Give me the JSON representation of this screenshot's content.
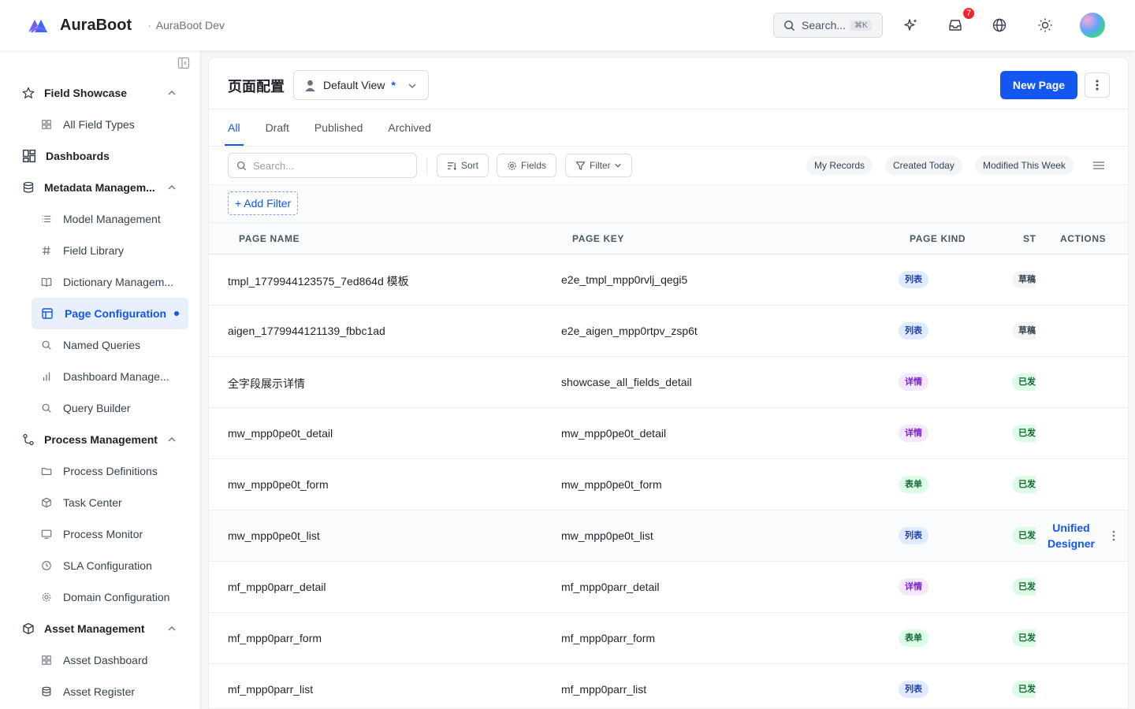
{
  "header": {
    "brand": "AuraBoot",
    "separator": "·",
    "environment": "AuraBoot Dev",
    "search_label": "Search...",
    "search_shortcut": "⌘K",
    "notification_count": "7",
    "icons": [
      "sparkle-icon",
      "inbox-icon",
      "globe-icon",
      "sun-icon"
    ]
  },
  "sidebar": {
    "items": [
      {
        "label": "Field Showcase",
        "kind": "group",
        "icon": "star-icon"
      },
      {
        "label": "All Field Types",
        "kind": "child",
        "icon": "grid-icon"
      },
      {
        "label": "Dashboards",
        "kind": "top",
        "icon": "dashboard-icon"
      },
      {
        "label": "Metadata Managem...",
        "kind": "group",
        "icon": "database-icon"
      },
      {
        "label": "Model Management",
        "kind": "child",
        "icon": "list-icon"
      },
      {
        "label": "Field Library",
        "kind": "child",
        "icon": "hash-icon"
      },
      {
        "label": "Dictionary Managem...",
        "kind": "child",
        "icon": "book-icon"
      },
      {
        "label": "Page Configuration",
        "kind": "active",
        "icon": "layout-icon"
      },
      {
        "label": "Named Queries",
        "kind": "child",
        "icon": "search-icon"
      },
      {
        "label": "Dashboard Manage...",
        "kind": "child",
        "icon": "bar-chart-icon"
      },
      {
        "label": "Query Builder",
        "kind": "child",
        "icon": "search-icon"
      },
      {
        "label": "Process Management",
        "kind": "group",
        "icon": "flow-icon"
      },
      {
        "label": "Process Definitions",
        "kind": "child",
        "icon": "folder-icon"
      },
      {
        "label": "Task Center",
        "kind": "child",
        "icon": "box-icon"
      },
      {
        "label": "Process Monitor",
        "kind": "child",
        "icon": "monitor-icon"
      },
      {
        "label": "SLA Configuration",
        "kind": "child",
        "icon": "clock-icon"
      },
      {
        "label": "Domain Configuration",
        "kind": "child",
        "icon": "gear-icon"
      },
      {
        "label": "Asset Management",
        "kind": "group",
        "icon": "cube-icon"
      },
      {
        "label": "Asset Dashboard",
        "kind": "child",
        "icon": "grid-icon"
      },
      {
        "label": "Asset Register",
        "kind": "child",
        "icon": "database-icon"
      }
    ]
  },
  "page": {
    "title": "页面配置",
    "view_name": "Default View",
    "view_dirty_marker": "*",
    "new_button": "New Page"
  },
  "tabs": [
    "All",
    "Draft",
    "Published",
    "Archived"
  ],
  "toolbar": {
    "search_placeholder": "Search...",
    "sort": "Sort",
    "fields": "Fields",
    "filter": "Filter",
    "quick_filters": [
      "My Records",
      "Created Today",
      "Modified This Week"
    ],
    "add_filter": "+ Add Filter"
  },
  "table": {
    "columns": [
      "PAGE NAME",
      "PAGE KEY",
      "PAGE KIND",
      "ST",
      "ACTIONS"
    ],
    "rows": [
      {
        "name": "tmpl_1779944123575_7ed864d 模板",
        "key": "e2e_tmpl_mpp0rvlj_qegi5",
        "kind": "列表",
        "kind_type": "list",
        "status": "草稿",
        "status_type": "draft"
      },
      {
        "name": "aigen_1779944121139_fbbc1ad",
        "key": "e2e_aigen_mpp0rtpv_zsp6t",
        "kind": "列表",
        "kind_type": "list",
        "status": "草稿",
        "status_type": "draft"
      },
      {
        "name": "全字段展示详情",
        "key": "showcase_all_fields_detail",
        "kind": "详情",
        "kind_type": "detail",
        "status": "已发",
        "status_type": "pub"
      },
      {
        "name": "mw_mpp0pe0t_detail",
        "key": "mw_mpp0pe0t_detail",
        "kind": "详情",
        "kind_type": "detail",
        "status": "已发",
        "status_type": "pub"
      },
      {
        "name": "mw_mpp0pe0t_form",
        "key": "mw_mpp0pe0t_form",
        "kind": "表单",
        "kind_type": "form",
        "status": "已发",
        "status_type": "pub"
      },
      {
        "name": "mw_mpp0pe0t_list",
        "key": "mw_mpp0pe0t_list",
        "kind": "列表",
        "kind_type": "list",
        "status": "已发",
        "status_type": "pub",
        "action": "Unified Designer"
      },
      {
        "name": "mf_mpp0parr_detail",
        "key": "mf_mpp0parr_detail",
        "kind": "详情",
        "kind_type": "detail",
        "status": "已发",
        "status_type": "pub"
      },
      {
        "name": "mf_mpp0parr_form",
        "key": "mf_mpp0parr_form",
        "kind": "表单",
        "kind_type": "form",
        "status": "已发",
        "status_type": "pub"
      },
      {
        "name": "mf_mpp0parr_list",
        "key": "mf_mpp0parr_list",
        "kind": "列表",
        "kind_type": "list",
        "status": "已发",
        "status_type": "pub"
      }
    ]
  },
  "colors": {
    "accent": "#1456f0",
    "badge": "#f5222d"
  }
}
